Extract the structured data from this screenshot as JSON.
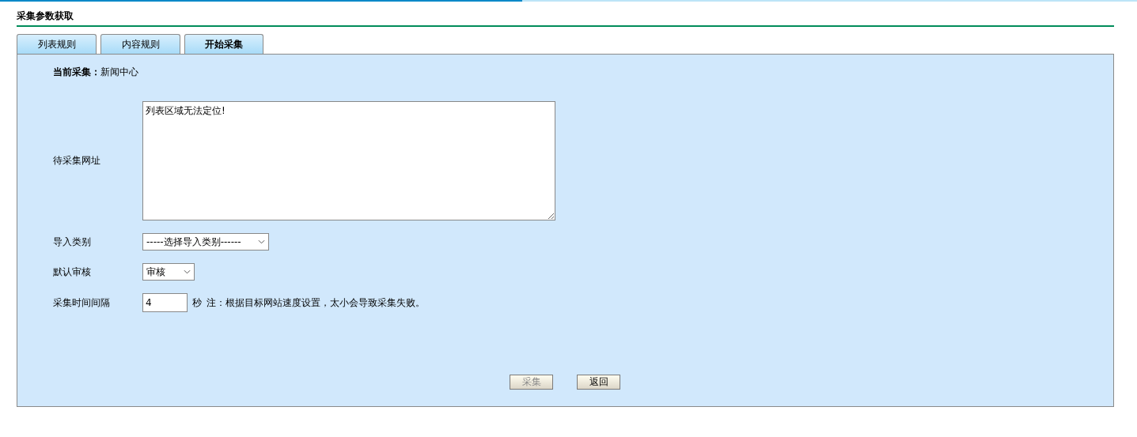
{
  "page_title": "采集参数获取",
  "tabs": [
    {
      "label": "列表规则",
      "selected": false
    },
    {
      "label": "内容规则",
      "selected": false
    },
    {
      "label": "开始采集",
      "selected": true
    }
  ],
  "current": {
    "label": "当前采集：",
    "value": "新闻中心"
  },
  "form": {
    "urls": {
      "label": "待采集网址",
      "value": "列表区域无法定位!"
    },
    "category": {
      "label": "导入类别",
      "value": "-----选择导入类别------"
    },
    "review": {
      "label": "默认审核",
      "value": "审核"
    },
    "interval": {
      "label": "采集时间间隔",
      "value": "4",
      "unit": "秒",
      "note": "注：根据目标网站速度设置，太小会导致采集失败。"
    }
  },
  "buttons": [
    {
      "label": "采集",
      "disabled": true
    },
    {
      "label": "返回",
      "disabled": false
    }
  ]
}
